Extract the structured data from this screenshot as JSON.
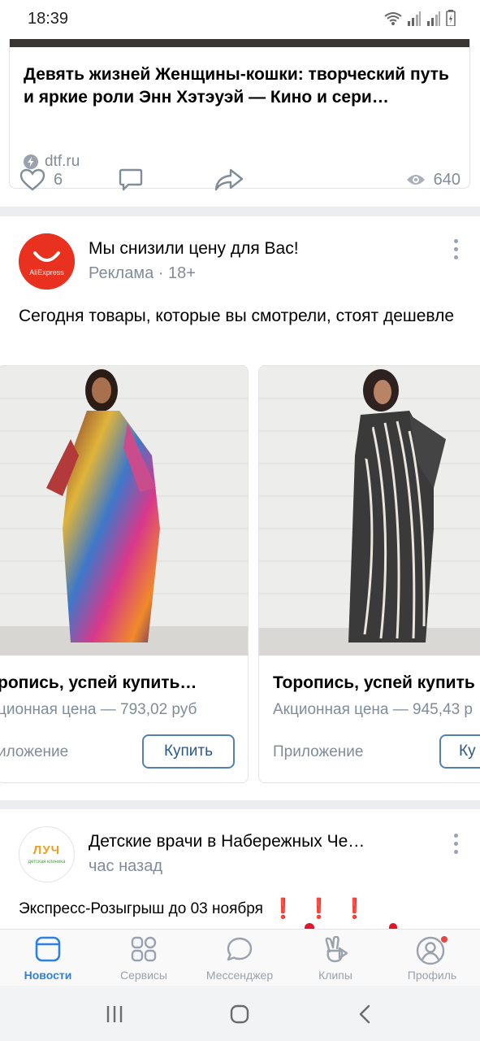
{
  "status_bar": {
    "time": "18:39"
  },
  "link_post": {
    "title": "Девять жизней Женщины-кошки: творческий путь и яркие роли Энн Хэтэуэй — Кино и сери…",
    "source": "dtf.ru",
    "likes": "6",
    "views": "640"
  },
  "ad_post": {
    "avatar_text": "AliExpress",
    "title": "Мы снизили цену для Вас!",
    "subtitle": "Реклама · 18+",
    "text": "Сегодня товары, которые вы смотрели, стоят дешевле",
    "products": [
      {
        "title": "ропись, успей купить…",
        "price": "ционная цена — 793,02 руб",
        "app": "иложение",
        "button": "Купить"
      },
      {
        "title": "Торопись, успей купить",
        "price": "Акционная цена — 945,43 р",
        "app": "Приложение",
        "button": "Ку"
      }
    ]
  },
  "next_post": {
    "avatar_logo": "ЛУЧ",
    "avatar_caption": "детская клиника",
    "title": "Детские врачи в Набережных Че…",
    "subtitle": "час назад",
    "text": "Экспресс-Розыгрыш до 03 ноября"
  },
  "tabs": [
    {
      "label": "Новости",
      "icon": "news-icon",
      "active": true
    },
    {
      "label": "Сервисы",
      "icon": "services-icon",
      "active": false
    },
    {
      "label": "Мессенджер",
      "icon": "messenger-icon",
      "active": false
    },
    {
      "label": "Клипы",
      "icon": "clips-icon",
      "active": false
    },
    {
      "label": "Профиль",
      "icon": "profile-icon",
      "active": false
    }
  ],
  "colors": {
    "accent": "#2a5885",
    "active_tab": "#2d81e0",
    "muted": "#818c99",
    "aliexpress": "#e8311f"
  }
}
